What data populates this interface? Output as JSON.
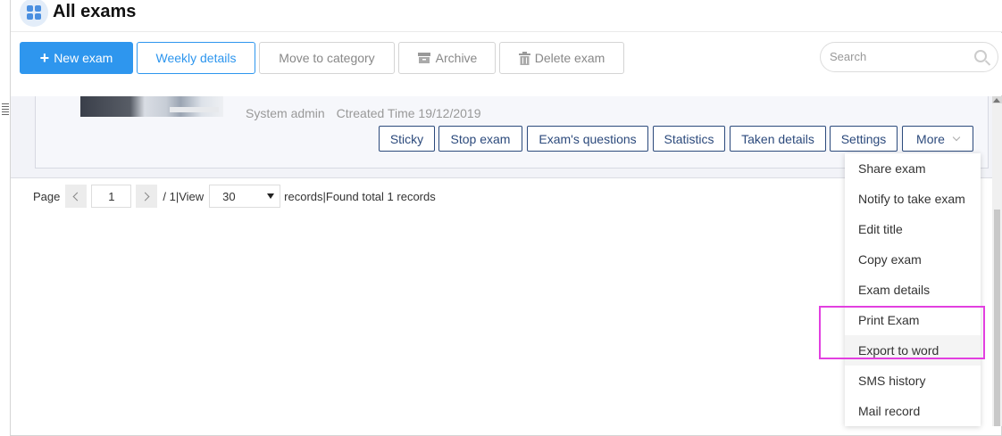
{
  "header": {
    "title": "All exams"
  },
  "toolbar": {
    "new_exam": "New exam",
    "weekly_details": "Weekly details",
    "move_to_category": "Move to category",
    "archive": "Archive",
    "delete_exam": "Delete exam"
  },
  "search": {
    "placeholder": "Search"
  },
  "exam": {
    "author": "System admin",
    "created": "Ctreated Time 19/12/2019",
    "actions": {
      "sticky": "Sticky",
      "stop_exam": "Stop exam",
      "questions": "Exam's questions",
      "statistics": "Statistics",
      "taken_details": "Taken details",
      "settings": "Settings",
      "more": "More"
    }
  },
  "pagination": {
    "page_label": "Page",
    "current_page": "1",
    "total_text": "/ 1|View",
    "page_size": "30",
    "records_text": "records|Found total 1 records"
  },
  "more_menu": [
    "Share exam",
    "Notify to take exam",
    "Edit title",
    "Copy exam",
    "Exam details",
    "Print Exam",
    "Export to word",
    "SMS history",
    "Mail record"
  ],
  "colors": {
    "primary": "#2e96ee",
    "action_border": "#2c4a7c",
    "highlight": "#e23fe0"
  }
}
